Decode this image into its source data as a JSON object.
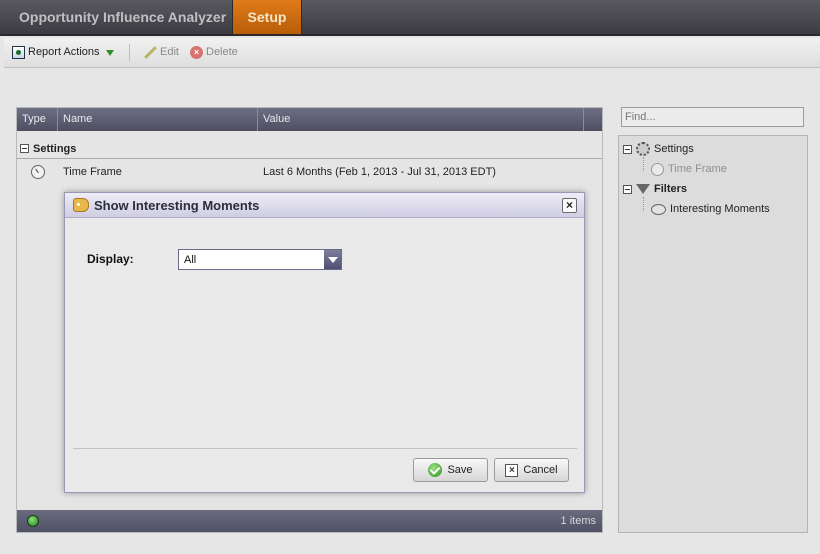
{
  "header": {
    "app_title": "Opportunity Influence Analyzer",
    "tab_setup": "Setup"
  },
  "toolbar": {
    "report_actions": "Report Actions",
    "edit": "Edit",
    "delete": "Delete"
  },
  "grid": {
    "columns": [
      "Type",
      "Name",
      "Value"
    ],
    "group_label": "Settings",
    "row": {
      "name": "Time Frame",
      "value": "Last 6 Months (Feb 1, 2013 - Jul 31, 2013 EDT)"
    },
    "items_count": "1 items"
  },
  "tree": {
    "find_placeholder": "Find...",
    "nodes": {
      "settings": "Settings",
      "time_frame": "Time Frame",
      "filters": "Filters",
      "interesting_moments": "Interesting Moments"
    }
  },
  "dialog": {
    "title": "Show Interesting Moments",
    "close": "×",
    "display_label": "Display:",
    "display_value": "All",
    "save": "Save",
    "cancel": "Cancel"
  },
  "icons": [
    "report-icon",
    "edit-icon",
    "delete-icon",
    "clock-icon",
    "gear-icon",
    "funnel-icon",
    "bubble-icon",
    "tag-icon",
    "check-icon",
    "x-icon",
    "status-icon"
  ],
  "colors": {
    "accent_tab": "#d06f12",
    "header_bg": "#4a4a50",
    "grid_header": "#5f5f73",
    "dialog_title_bg": "#dcdaee"
  }
}
